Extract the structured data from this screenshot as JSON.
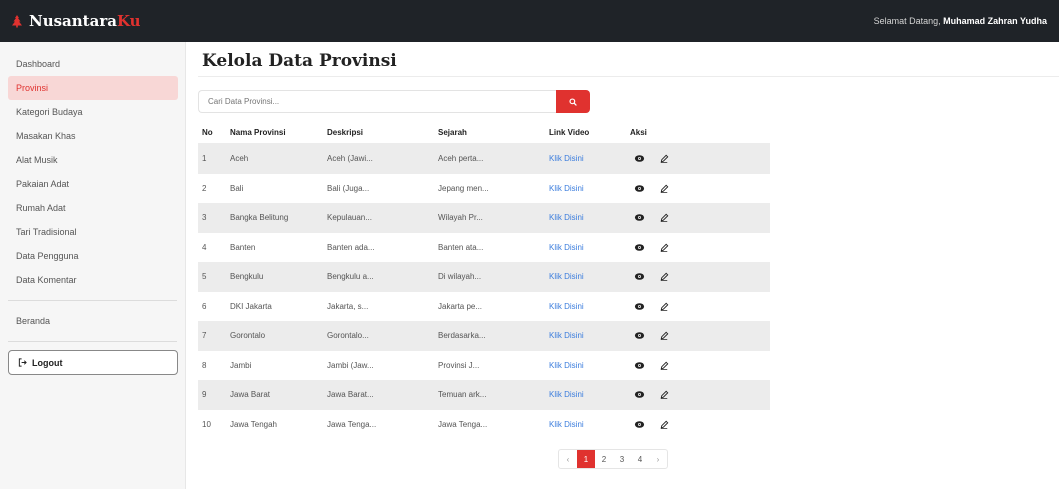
{
  "brand": {
    "name_main": "Nusantara",
    "name_accent": "Ku"
  },
  "header": {
    "welcome_prefix": "Selamat Datang,",
    "user_name": "Muhamad Zahran Yudha"
  },
  "sidebar": {
    "items": [
      {
        "label": "Dashboard",
        "active": false
      },
      {
        "label": "Provinsi",
        "active": true
      },
      {
        "label": "Kategori Budaya",
        "active": false
      },
      {
        "label": "Masakan Khas",
        "active": false
      },
      {
        "label": "Alat Musik",
        "active": false
      },
      {
        "label": "Pakaian Adat",
        "active": false
      },
      {
        "label": "Rumah Adat",
        "active": false
      },
      {
        "label": "Tari Tradisional",
        "active": false
      },
      {
        "label": "Data Pengguna",
        "active": false
      },
      {
        "label": "Data Komentar",
        "active": false
      }
    ],
    "beranda": "Beranda",
    "logout": "Logout"
  },
  "page": {
    "title": "Kelola Data Provinsi"
  },
  "search": {
    "placeholder": "Cari Data Provinsi..."
  },
  "table": {
    "headers": {
      "no": "No",
      "nama": "Nama Provinsi",
      "deskripsi": "Deskripsi",
      "sejarah": "Sejarah",
      "link": "Link Video",
      "aksi": "Aksi"
    },
    "rows": [
      {
        "no": "1",
        "nama": "Aceh",
        "deskripsi": "Aceh (Jawi...",
        "sejarah": "Aceh perta...",
        "link": "Klik Disini"
      },
      {
        "no": "2",
        "nama": "Bali",
        "deskripsi": "Bali (Juga...",
        "sejarah": "Jepang men...",
        "link": "Klik Disini"
      },
      {
        "no": "3",
        "nama": "Bangka Belitung",
        "deskripsi": "Kepulauan...",
        "sejarah": "Wilayah Pr...",
        "link": "Klik Disini"
      },
      {
        "no": "4",
        "nama": "Banten",
        "deskripsi": "Banten ada...",
        "sejarah": "Banten ata...",
        "link": "Klik Disini"
      },
      {
        "no": "5",
        "nama": "Bengkulu",
        "deskripsi": "Bengkulu a...",
        "sejarah": "Di wilayah...",
        "link": "Klik Disini"
      },
      {
        "no": "6",
        "nama": "DKI Jakarta",
        "deskripsi": "Jakarta, s...",
        "sejarah": "Jakarta pe...",
        "link": "Klik Disini"
      },
      {
        "no": "7",
        "nama": "Gorontalo",
        "deskripsi": "Gorontalo...",
        "sejarah": "Berdasarka...",
        "link": "Klik Disini"
      },
      {
        "no": "8",
        "nama": "Jambi",
        "deskripsi": "Jambi (Jaw...",
        "sejarah": "Provinsi J...",
        "link": "Klik Disini"
      },
      {
        "no": "9",
        "nama": "Jawa Barat",
        "deskripsi": "Jawa Barat...",
        "sejarah": "Temuan ark...",
        "link": "Klik Disini"
      },
      {
        "no": "10",
        "nama": "Jawa Tengah",
        "deskripsi": "Jawa Tenga...",
        "sejarah": "Jawa Tenga...",
        "link": "Klik Disini"
      }
    ]
  },
  "pagination": {
    "prev": "‹",
    "pages": [
      "1",
      "2",
      "3",
      "4"
    ],
    "active": "1",
    "next": "›"
  },
  "icons": {
    "view": "eye-icon",
    "edit": "pencil-icon",
    "search": "search-icon",
    "logout": "logout-icon",
    "brand": "brand-logo-icon"
  },
  "colors": {
    "accent": "#e0322f",
    "topbar": "#1f2328",
    "link": "#3b7ddd",
    "active_bg": "#f8d7d6"
  }
}
